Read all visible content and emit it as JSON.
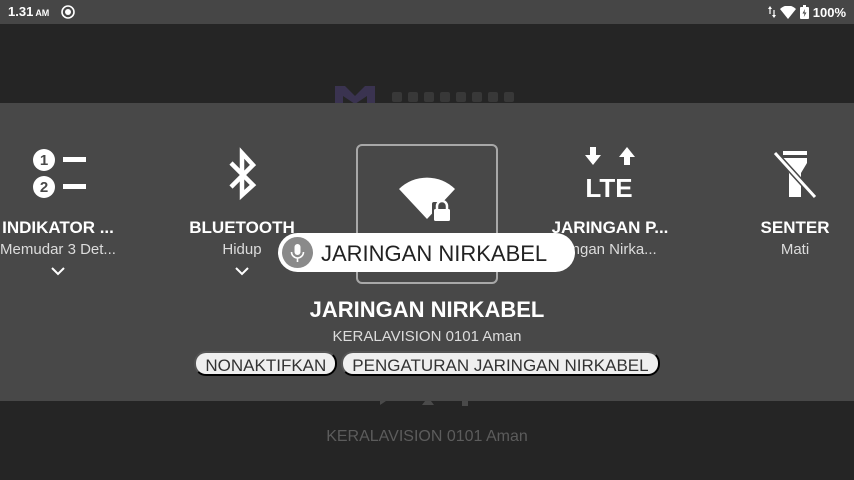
{
  "status_bar": {
    "time": "1.31",
    "ampm": "AM",
    "battery": "100%"
  },
  "background": {
    "network_label": "KERALAVISION 0101 Aman"
  },
  "quick_settings": {
    "tiles": [
      {
        "title": "INDIKATOR ...",
        "subtitle": "Memudar 3 Det...",
        "icon": "numbered-list-icon",
        "expandable": true
      },
      {
        "title": "BLUETOOTH",
        "subtitle": "Hidup",
        "icon": "bluetooth-icon",
        "expandable": true
      },
      {
        "title": "JARINGAN NIRKABEL",
        "subtitle": "",
        "icon": "wifi-lock-icon",
        "focused": true
      },
      {
        "title": "JARINGAN P...",
        "subtitle": "ringan Nirka...",
        "icon": "lte-icon"
      },
      {
        "title": "SENTER",
        "subtitle": "Mati",
        "icon": "flashlight-off-icon"
      }
    ],
    "speech_bubble": "JARINGAN NIRKABEL",
    "detail": {
      "title": "JARINGAN NIRKABEL",
      "subtitle": "KERALAVISION 0101 Aman",
      "buttons": [
        "NONAKTIFKAN",
        "PENGATURAN JARINGAN NIRKABEL"
      ]
    }
  },
  "colors": {
    "panel": "#484848",
    "status_bar": "#464646",
    "background": "#252525"
  }
}
